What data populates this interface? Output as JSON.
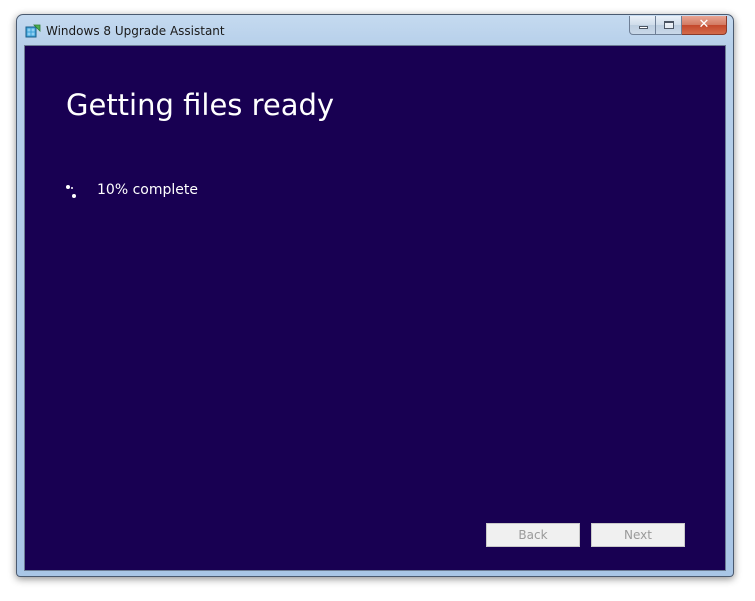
{
  "window": {
    "title": "Windows 8 Upgrade Assistant",
    "icon": "windows-upgrade-icon",
    "controls": {
      "minimize_icon": "minimize-icon",
      "maximize_icon": "maximize-icon",
      "close_icon": "close-icon",
      "close_glyph": "✕"
    }
  },
  "main": {
    "heading": "Getting files ready",
    "progress": {
      "percent": 10,
      "text": "10% complete",
      "indicator_icon": "spinner-icon"
    }
  },
  "footer": {
    "back_label": "Back",
    "next_label": "Next",
    "back_enabled": false,
    "next_enabled": false
  },
  "colors": {
    "client_background": "#180052",
    "text": "#ffffff",
    "button_disabled_text": "#9a9a9a"
  }
}
